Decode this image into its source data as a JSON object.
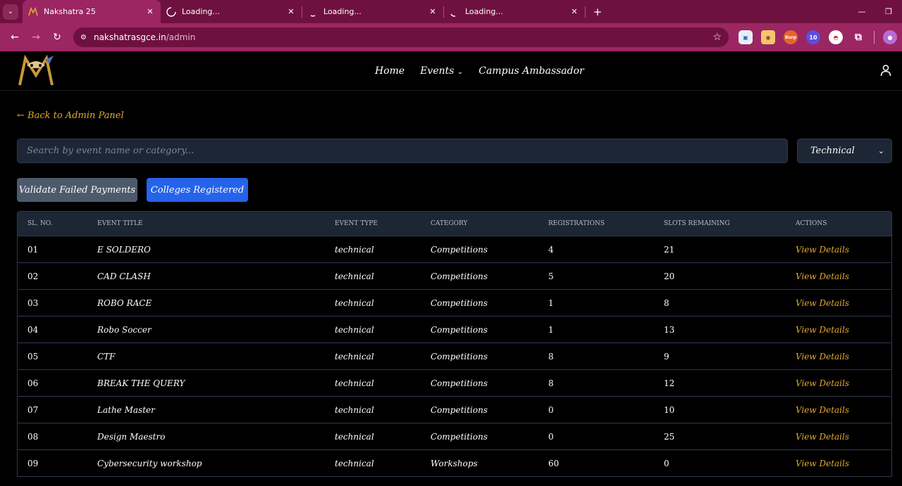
{
  "browser": {
    "tabs": [
      {
        "title": "Nakshatra 25",
        "active": true
      },
      {
        "title": "Loading...",
        "active": false
      },
      {
        "title": "Loading...",
        "active": false
      },
      {
        "title": "Loading...",
        "active": false
      }
    ],
    "url_host": "nakshatrasgce.in",
    "url_path": "/admin",
    "extensions": {
      "burp": "Burp",
      "badge_count": "10"
    }
  },
  "site": {
    "nav": {
      "home": "Home",
      "events": "Events",
      "campus": "Campus Ambassador"
    },
    "back_link": "← Back to Admin Panel",
    "search_placeholder": "Search by event name or category...",
    "filter_selected": "Technical",
    "buttons": {
      "validate": "Validate Failed Payments",
      "colleges": "Colleges Registered"
    }
  },
  "table": {
    "headers": [
      "SL. NO.",
      "EVENT TITLE",
      "EVENT TYPE",
      "CATEGORY",
      "REGISTRATIONS",
      "SLOTS REMAINING",
      "ACTIONS"
    ],
    "rows": [
      {
        "sl": "01",
        "title": "E SOLDERO",
        "type": "technical",
        "category": "Competitions",
        "registrations": "4",
        "slots": "21",
        "action": "View Details"
      },
      {
        "sl": "02",
        "title": "CAD CLASH",
        "type": "technical",
        "category": "Competitions",
        "registrations": "5",
        "slots": "20",
        "action": "View Details"
      },
      {
        "sl": "03",
        "title": "ROBO RACE",
        "type": "technical",
        "category": "Competitions",
        "registrations": "1",
        "slots": "8",
        "action": "View Details"
      },
      {
        "sl": "04",
        "title": "Robo Soccer",
        "type": "technical",
        "category": "Competitions",
        "registrations": "1",
        "slots": "13",
        "action": "View Details"
      },
      {
        "sl": "05",
        "title": "CTF",
        "type": "technical",
        "category": "Competitions",
        "registrations": "8",
        "slots": "9",
        "action": "View Details"
      },
      {
        "sl": "06",
        "title": "BREAK THE QUERY",
        "type": "technical",
        "category": "Competitions",
        "registrations": "8",
        "slots": "12",
        "action": "View Details"
      },
      {
        "sl": "07",
        "title": "Lathe Master",
        "type": "technical",
        "category": "Competitions",
        "registrations": "0",
        "slots": "10",
        "action": "View Details"
      },
      {
        "sl": "08",
        "title": "Design Maestro",
        "type": "technical",
        "category": "Competitions",
        "registrations": "0",
        "slots": "25",
        "action": "View Details"
      },
      {
        "sl": "09",
        "title": "Cybersecurity workshop",
        "type": "technical",
        "category": "Workshops",
        "registrations": "60",
        "slots": "0",
        "action": "View Details"
      }
    ]
  },
  "colors": {
    "accent": "#e3a82e",
    "primary_button": "#2563eb",
    "browser_frame": "#9b2662"
  }
}
